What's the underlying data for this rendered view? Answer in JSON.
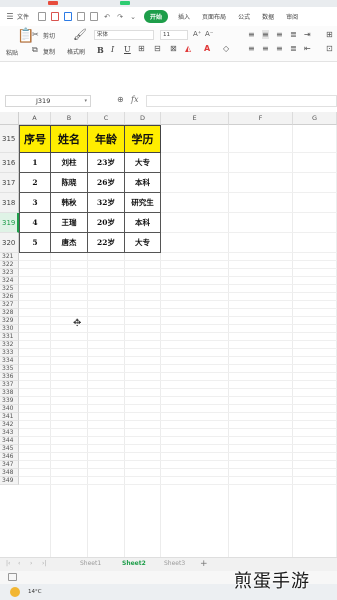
{
  "menubar": {
    "file_label": "文件",
    "tabs": [
      {
        "label": "开始",
        "active": true
      },
      {
        "label": "插入",
        "active": false
      },
      {
        "label": "页面布局",
        "active": false
      },
      {
        "label": "公式",
        "active": false
      },
      {
        "label": "数据",
        "active": false
      },
      {
        "label": "审阅",
        "active": false
      }
    ]
  },
  "ribbon": {
    "cut_label": "剪切",
    "paste_label": "粘贴",
    "copy_label": "复制",
    "format_painter_label": "格式刷",
    "font_name": "宋体",
    "font_size": "11",
    "bold": "B",
    "italic": "I",
    "underline": "U"
  },
  "formula_bar": {
    "cell_ref": "J319",
    "fx_label": "fx",
    "value": ""
  },
  "columns": [
    "A",
    "B",
    "C",
    "D",
    "E",
    "F",
    "G"
  ],
  "table": {
    "header_row_number": "315",
    "headers": [
      "序号",
      "姓名",
      "年龄",
      "学历"
    ],
    "rows": [
      {
        "row_number": "316",
        "cells": [
          "1",
          "刘柱",
          "23岁",
          "大专"
        ]
      },
      {
        "row_number": "317",
        "cells": [
          "2",
          "陈晓",
          "26岁",
          "本科"
        ]
      },
      {
        "row_number": "318",
        "cells": [
          "3",
          "韩秋",
          "32岁",
          "研究生"
        ]
      },
      {
        "row_number": "319",
        "cells": [
          "4",
          "王瑞",
          "20岁",
          "本科"
        ]
      },
      {
        "row_number": "320",
        "cells": [
          "5",
          "唐杰",
          "22岁",
          "大专"
        ]
      }
    ]
  },
  "empty_rows": [
    "321",
    "322",
    "323",
    "324",
    "325",
    "326",
    "327",
    "328",
    "329",
    "330",
    "331",
    "332",
    "333",
    "334",
    "335",
    "336",
    "337",
    "338",
    "339",
    "340",
    "341",
    "342",
    "343",
    "344",
    "345",
    "346",
    "347",
    "348",
    "349"
  ],
  "selected_row": "319",
  "sheets": [
    {
      "label": "Sheet1",
      "active": false
    },
    {
      "label": "Sheet2",
      "active": true
    },
    {
      "label": "Sheet3",
      "active": false
    }
  ],
  "sheet_add": "+",
  "taskbar": {
    "temperature": "14°C"
  },
  "watermark": "煎蛋手游",
  "colors": {
    "accent": "#1e9e4a",
    "header_fill": "#ffed00"
  }
}
